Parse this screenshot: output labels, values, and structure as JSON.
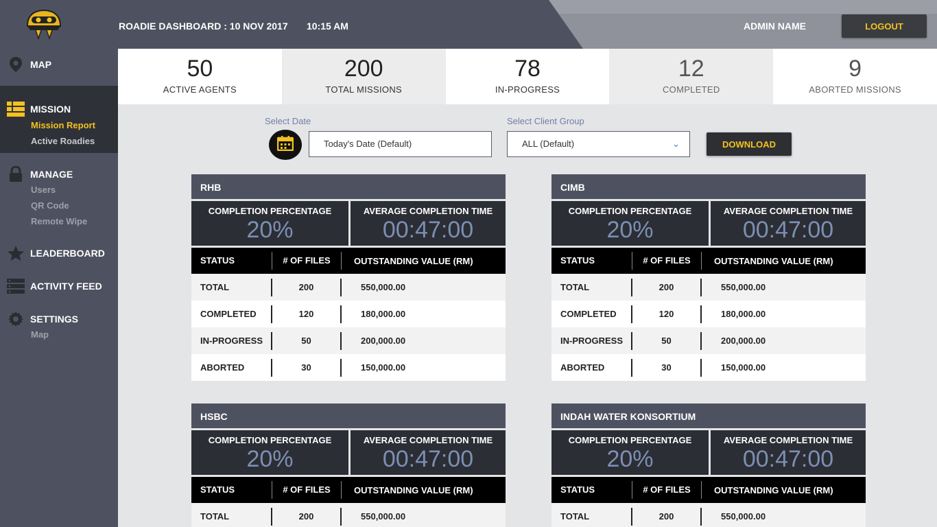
{
  "header": {
    "title": "ROADIE DASHBOARD : 10 NOV 2017",
    "time": "10:15 AM",
    "admin": "ADMIN NAME",
    "logout_label": "LOGOUT"
  },
  "sidebar": {
    "groups": [
      {
        "label": "MAP",
        "icon": "map-pin-icon",
        "items": []
      },
      {
        "label": "MISSION",
        "icon": "list-icon",
        "items": [
          "Mission Report",
          "Active Roadies"
        ]
      },
      {
        "label": "MANAGE",
        "icon": "lock-icon",
        "items": [
          "Users",
          "QR Code",
          "Remote Wipe"
        ]
      },
      {
        "label": "LEADERBOARD",
        "icon": "star-icon",
        "items": []
      },
      {
        "label": "ACTIVITY FEED",
        "icon": "server-icon",
        "items": []
      },
      {
        "label": "SETTINGS",
        "icon": "gear-icon",
        "items": [
          "Map"
        ]
      }
    ]
  },
  "stats": [
    {
      "value": "50",
      "label": "ACTIVE AGENTS"
    },
    {
      "value": "200",
      "label": "TOTAL MISSIONS"
    },
    {
      "value": "78",
      "label": "IN-PROGRESS"
    },
    {
      "value": "12",
      "label": "COMPLETED"
    },
    {
      "value": "9",
      "label": "ABORTED MISSIONS"
    }
  ],
  "filters": {
    "date_label": "Select Date",
    "date_value": "Today's Date (Default)",
    "client_label": "Select Client Group",
    "client_value": "ALL (Default)",
    "download_label": "DOWNLOAD"
  },
  "colors": {
    "accent": "#f3c220",
    "sidebar": "#4e5260",
    "metric_value": "#7c8fb4"
  },
  "card_labels": {
    "completion": "COMPLETION PERCENTAGE",
    "avg_time": "AVERAGE COMPLETION TIME",
    "col_status": "STATUS",
    "col_files": "# OF FILES",
    "col_value": "OUTSTANDING VALUE (RM)"
  },
  "cards": [
    {
      "name": "RHB",
      "completion": "20%",
      "avg_time": "00:47:00",
      "rows": [
        {
          "status": "TOTAL",
          "files": "200",
          "value": "550,000.00"
        },
        {
          "status": "COMPLETED",
          "files": "120",
          "value": "180,000.00"
        },
        {
          "status": "IN-PROGRESS",
          "files": "50",
          "value": "200,000.00"
        },
        {
          "status": "ABORTED",
          "files": "30",
          "value": "150,000.00"
        }
      ]
    },
    {
      "name": "CIMB",
      "completion": "20%",
      "avg_time": "00:47:00",
      "rows": [
        {
          "status": "TOTAL",
          "files": "200",
          "value": "550,000.00"
        },
        {
          "status": "COMPLETED",
          "files": "120",
          "value": "180,000.00"
        },
        {
          "status": "IN-PROGRESS",
          "files": "50",
          "value": "200,000.00"
        },
        {
          "status": "ABORTED",
          "files": "30",
          "value": "150,000.00"
        }
      ]
    },
    {
      "name": "HSBC",
      "completion": "20%",
      "avg_time": "00:47:00",
      "rows": [
        {
          "status": "TOTAL",
          "files": "200",
          "value": "550,000.00"
        }
      ]
    },
    {
      "name": "INDAH WATER KONSORTIUM",
      "completion": "20%",
      "avg_time": "00:47:00",
      "rows": [
        {
          "status": "TOTAL",
          "files": "200",
          "value": "550,000.00"
        }
      ]
    }
  ]
}
